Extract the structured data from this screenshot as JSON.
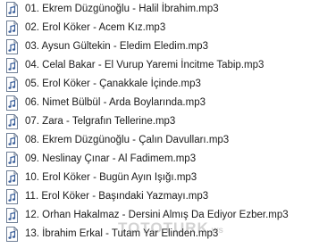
{
  "files": [
    {
      "name": "01. Ekrem Düzgünoğlu - Halil İbrahim.mp3",
      "icon": "audio-file-icon"
    },
    {
      "name": "02. Erol Köker - Acem Kız.mp3",
      "icon": "audio-file-icon"
    },
    {
      "name": "03. Aysun Gültekin - Eledim Eledim.mp3",
      "icon": "audio-file-icon"
    },
    {
      "name": "04. Celal Bakar - El Vurup Yaremi İncitme Tabip.mp3",
      "icon": "audio-file-icon"
    },
    {
      "name": "05. Erol Köker - Çanakkale İçinde.mp3",
      "icon": "audio-file-icon"
    },
    {
      "name": "06. Nimet Bülbül - Arda Boylarında.mp3",
      "icon": "audio-file-icon"
    },
    {
      "name": "07. Zara - Telgrafın Tellerine.mp3",
      "icon": "audio-file-icon"
    },
    {
      "name": "08. Ekrem Düzgünoğlu - Çalın Davulları.mp3",
      "icon": "audio-file-icon"
    },
    {
      "name": "09. Neslinay Çınar - Al Fadimem.mp3",
      "icon": "audio-file-icon"
    },
    {
      "name": "10. Erol Köker - Bugün Ayın Işığı.mp3",
      "icon": "audio-file-icon"
    },
    {
      "name": "11. Erol Köker - Başındaki Yazmayı.mp3",
      "icon": "audio-file-icon"
    },
    {
      "name": "12. Orhan Hakalmaz - Dersini Almış Da Ediyor Ezber.mp3",
      "icon": "audio-file-icon"
    },
    {
      "name": "13. İbrahim Erkal - Tutam Yar Elinden.mp3",
      "icon": "audio-file-icon"
    }
  ],
  "watermark": {
    "text": "TOTOTURK",
    "suffix": ".ws"
  },
  "colors": {
    "icon_border": "#6f7f96",
    "icon_fill": "#ffffff",
    "note": "#3a5f9a",
    "text": "#1a1a1a"
  }
}
